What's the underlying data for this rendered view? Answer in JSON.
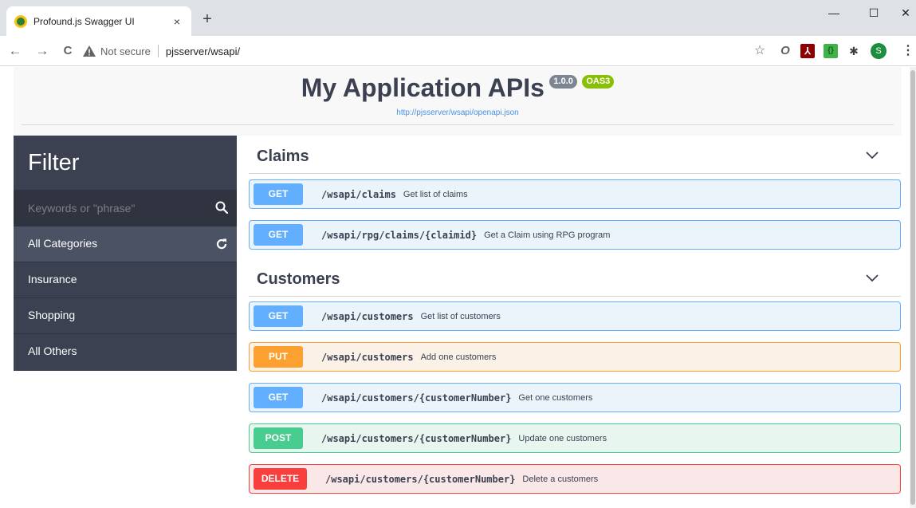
{
  "browser": {
    "tab_title": "Profound.js Swagger UI",
    "tab_close": "×",
    "new_tab": "+",
    "nav": {
      "back": "←",
      "forward": "→",
      "reload": "C"
    },
    "security_label": "Not secure",
    "url": "pjsserver/wsapi/",
    "window": {
      "minimize": "—",
      "maximize": "☐",
      "close": "✕"
    },
    "extensions": {
      "star": "☆",
      "opera": "O",
      "pdf": "⅄",
      "green": "{}",
      "puzzle": "✱",
      "avatar": "S",
      "menu": "⋮"
    }
  },
  "header": {
    "title": "My Application APIs",
    "version_badge": "1.0.0",
    "oas_badge": "OAS3",
    "spec_link": "http://pjsserver/wsapi/openapi.json"
  },
  "sidebar": {
    "title": "Filter",
    "search_placeholder": "Keywords or \"phrase\"",
    "categories": [
      {
        "label": "All Categories"
      },
      {
        "label": "Insurance"
      },
      {
        "label": "Shopping"
      },
      {
        "label": "All Others"
      }
    ]
  },
  "sections": [
    {
      "title": "Claims",
      "operations": [
        {
          "method": "GET",
          "path": "/wsapi/claims",
          "summary": "Get list of claims"
        },
        {
          "method": "GET",
          "path": "/wsapi/rpg/claims/{claimid}",
          "summary": "Get a Claim using RPG program"
        }
      ]
    },
    {
      "title": "Customers",
      "operations": [
        {
          "method": "GET",
          "path": "/wsapi/customers",
          "summary": "Get list of customers"
        },
        {
          "method": "PUT",
          "path": "/wsapi/customers",
          "summary": "Add one customers"
        },
        {
          "method": "GET",
          "path": "/wsapi/customers/{customerNumber}",
          "summary": "Get one customers"
        },
        {
          "method": "POST",
          "path": "/wsapi/customers/{customerNumber}",
          "summary": "Update one customers"
        },
        {
          "method": "DELETE",
          "path": "/wsapi/customers/{customerNumber}",
          "summary": "Delete a customers"
        }
      ]
    }
  ],
  "colors": {
    "get": "#61affe",
    "put": "#fca130",
    "post": "#49cc90",
    "delete": "#f93e3e",
    "sidebar": "#3b4151"
  }
}
